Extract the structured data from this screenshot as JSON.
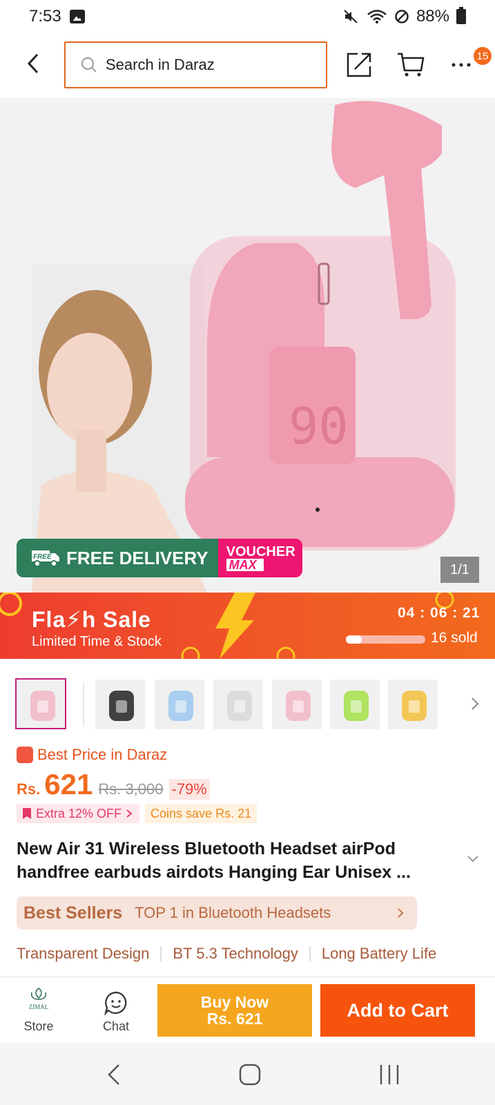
{
  "status_bar": {
    "time": "7:53",
    "battery": "88%"
  },
  "header": {
    "search_placeholder": "Search in Daraz",
    "more_badge": "15"
  },
  "hero": {
    "free_delivery": "FREE DELIVERY",
    "free_tag": "FREE",
    "voucher": "VOUCHER",
    "voucher_max": "MAX",
    "counter": "1/1",
    "case_display": "90"
  },
  "flash_sale": {
    "title": "Fla⚡h  Sale",
    "subtitle": "Limited Time & Stock",
    "timer": "04 : 06 : 21",
    "sold_fraction": 0.2,
    "sold": "16 sold"
  },
  "thumbnails": [
    {
      "color": "#f2b6c6",
      "selected": true
    },
    {
      "color": "#222222",
      "selected": false
    },
    {
      "color": "#9cc8ef",
      "selected": false
    },
    {
      "color": "#d8d8d8",
      "selected": false
    },
    {
      "color": "#f2b6c6",
      "selected": false
    },
    {
      "color": "#a3e047",
      "selected": false
    },
    {
      "color": "#f3c03a",
      "selected": false
    }
  ],
  "pricing": {
    "best_price": "Best Price in Daraz",
    "currency": "Rs.",
    "price": "621",
    "old_price": "Rs. 3,000",
    "discount": "-79%",
    "extra_off": "Extra 12% OFF",
    "coins": "Coins save Rs. 21"
  },
  "product": {
    "title": "New Air 31 Wireless Bluetooth Headset airPod handfree earbuds airdots Hanging Ear Unisex ..."
  },
  "best_sellers": {
    "label": "Best Sellers",
    "text": "TOP 1 in Bluetooth Headsets"
  },
  "features": [
    "Transparent Design",
    "BT 5.3 Technology",
    "Long Battery Life"
  ],
  "bottom_bar": {
    "store": "Store",
    "store_logo": "ZIMAL",
    "chat": "Chat",
    "buy_now": "Buy Now",
    "buy_now_price": "Rs. 621",
    "add_to_cart": "Add to Cart"
  },
  "colors": {
    "accent": "#f36a1d",
    "brand_orange": "#f6540c",
    "buy_now": "#f5a61e",
    "delivery_green": "#2f7e5c",
    "voucher_pink": "#ee1670"
  }
}
